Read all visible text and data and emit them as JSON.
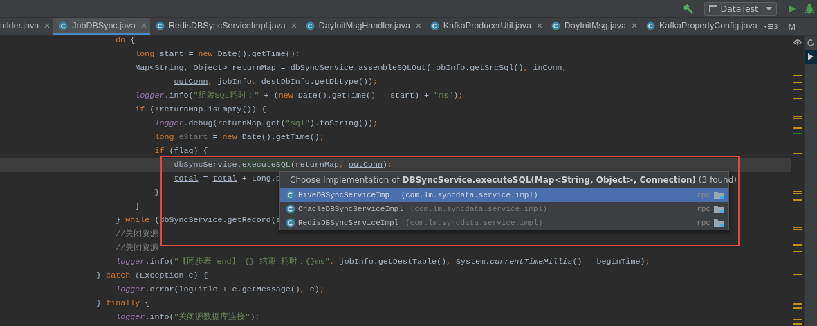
{
  "toolbar": {
    "run_config": "DataTest"
  },
  "tabs": [
    {
      "label": "uilder.java",
      "kind": "cut",
      "selected": false
    },
    {
      "label": "JobDBSync.java",
      "kind": "class",
      "selected": true
    },
    {
      "label": "RedisDBSyncServiceImpl.java",
      "kind": "class",
      "selected": false
    },
    {
      "label": "DayInitMsgHandler.java",
      "kind": "class",
      "selected": false
    },
    {
      "label": "KafkaProducerUtil.java",
      "kind": "class",
      "selected": false
    },
    {
      "label": "DayInitMsg.java",
      "kind": "class",
      "selected": false
    },
    {
      "label": "KafkaPropertyConfig.java",
      "kind": "class",
      "selected": false
    }
  ],
  "hidden_tabs_count": "3",
  "cut_tab": "M",
  "code_lines": [
    {
      "current": false,
      "tokens": [
        {
          "kind": "keyword",
          "text": "                    do"
        },
        {
          "kind": "plain",
          "text": " {"
        }
      ]
    },
    {
      "current": false,
      "tokens": [
        {
          "kind": "keyword",
          "text": "                        long"
        },
        {
          "kind": "plain",
          "text": " start = "
        },
        {
          "kind": "keyword",
          "text": "new"
        },
        {
          "kind": "plain",
          "text": " Date().getTime()"
        },
        {
          "kind": "keyword",
          "text": ";"
        }
      ]
    },
    {
      "current": false,
      "tokens": [
        {
          "kind": "plain",
          "text": "                        Map<String, Object> returnMap = dbSyncService.assembleSQLOut(jobInfo.getSrcSql()"
        },
        {
          "kind": "keyword",
          "text": ", "
        },
        {
          "kind": "reassigned",
          "text": "inConn"
        },
        {
          "kind": "keyword",
          "text": ","
        }
      ]
    },
    {
      "current": false,
      "tokens": [
        {
          "kind": "reassigned",
          "text": "                                outConn"
        },
        {
          "kind": "keyword",
          "text": ","
        },
        {
          "kind": "plain",
          "text": " jobInfo"
        },
        {
          "kind": "keyword",
          "text": ","
        },
        {
          "kind": "plain",
          "text": " destDbInfo.getDbtype())"
        },
        {
          "kind": "keyword",
          "text": ";"
        }
      ]
    },
    {
      "current": false,
      "tokens": [
        {
          "kind": "field",
          "text": "                        logger"
        },
        {
          "kind": "plain",
          "text": ".info("
        },
        {
          "kind": "string",
          "text": "\"组装SQL耗时：\""
        },
        {
          "kind": "plain",
          "text": " + ("
        },
        {
          "kind": "keyword",
          "text": "new"
        },
        {
          "kind": "plain",
          "text": " Date().getTime() - start) + "
        },
        {
          "kind": "string",
          "text": "\"ms\""
        },
        {
          "kind": "plain",
          "text": ")"
        },
        {
          "kind": "keyword",
          "text": ";"
        }
      ]
    },
    {
      "current": false,
      "tokens": [
        {
          "kind": "keyword",
          "text": "                        if"
        },
        {
          "kind": "plain",
          "text": " (!returnMap.isEmpty()) {"
        }
      ]
    },
    {
      "current": false,
      "tokens": [
        {
          "kind": "field",
          "text": "                            logger"
        },
        {
          "kind": "plain",
          "text": ".debug(returnMap.get("
        },
        {
          "kind": "string",
          "text": "\"sql\""
        },
        {
          "kind": "plain",
          "text": ").toString())"
        },
        {
          "kind": "keyword",
          "text": ";"
        }
      ]
    },
    {
      "current": false,
      "tokens": [
        {
          "kind": "keyword",
          "text": "                            long"
        },
        {
          "kind": "unused",
          "text": " eStart"
        },
        {
          "kind": "plain",
          "text": " = "
        },
        {
          "kind": "keyword",
          "text": "new"
        },
        {
          "kind": "plain",
          "text": " Date().getTime()"
        },
        {
          "kind": "keyword",
          "text": ";"
        }
      ]
    },
    {
      "current": false,
      "tokens": [
        {
          "kind": "keyword",
          "text": "                            if"
        },
        {
          "kind": "plain",
          "text": " ("
        },
        {
          "kind": "reassigned",
          "text": "flag"
        },
        {
          "kind": "plain",
          "text": ") {"
        }
      ]
    },
    {
      "current": true,
      "tokens": [
        {
          "kind": "plain",
          "text": "                                dbSyncService."
        },
        {
          "kind": "usage",
          "text": "executeSQL"
        },
        {
          "kind": "plain",
          "text": "(returnMap"
        },
        {
          "kind": "keyword",
          "text": ", "
        },
        {
          "kind": "reassigned",
          "text": "outConn"
        },
        {
          "kind": "plain",
          "text": ")"
        },
        {
          "kind": "keyword",
          "text": ";"
        }
      ]
    },
    {
      "current": false,
      "tokens": [
        {
          "kind": "reassigned",
          "text": "                                total"
        },
        {
          "kind": "plain",
          "text": " = "
        },
        {
          "kind": "reassigned",
          "text": "total"
        },
        {
          "kind": "plain",
          "text": " + Long.p"
        }
      ]
    },
    {
      "current": false,
      "tokens": [
        {
          "kind": "plain",
          "text": "                            }"
        }
      ]
    },
    {
      "current": false,
      "tokens": [
        {
          "kind": "plain",
          "text": "                        }"
        }
      ]
    },
    {
      "current": false,
      "tokens": [
        {
          "kind": "plain",
          "text": "                    } "
        },
        {
          "kind": "keyword",
          "text": "while"
        },
        {
          "kind": "plain",
          "text": " (dbSyncService.getRecord(s"
        }
      ]
    },
    {
      "current": false,
      "tokens": [
        {
          "kind": "comment",
          "text": "                    //关闭资源"
        }
      ]
    },
    {
      "current": false,
      "tokens": [
        {
          "kind": "comment",
          "text": "                    //关闭资源"
        }
      ]
    },
    {
      "current": false,
      "tokens": [
        {
          "kind": "field",
          "text": "                    logger"
        },
        {
          "kind": "plain",
          "text": ".info("
        },
        {
          "kind": "string",
          "text": "\"【同步表-end】 {} 结束 耗时：{}ms\""
        },
        {
          "kind": "keyword",
          "text": ","
        },
        {
          "kind": "plain",
          "text": " jobInfo.getDestTable()"
        },
        {
          "kind": "keyword",
          "text": ","
        },
        {
          "kind": "plain",
          "text": " System."
        },
        {
          "kind": "static",
          "text": "currentTimeMillis"
        },
        {
          "kind": "plain",
          "text": "() - beginTime)"
        },
        {
          "kind": "keyword",
          "text": ";"
        }
      ]
    },
    {
      "current": false,
      "tokens": [
        {
          "kind": "plain",
          "text": "                } "
        },
        {
          "kind": "keyword",
          "text": "catch"
        },
        {
          "kind": "plain",
          "text": " (Exception e) {"
        }
      ]
    },
    {
      "current": false,
      "tokens": [
        {
          "kind": "field",
          "text": "                    logger"
        },
        {
          "kind": "plain",
          "text": ".error(logTitle + e.getMessage()"
        },
        {
          "kind": "keyword",
          "text": ","
        },
        {
          "kind": "plain",
          "text": " e)"
        },
        {
          "kind": "keyword",
          "text": ";"
        }
      ]
    },
    {
      "current": false,
      "tokens": [
        {
          "kind": "plain",
          "text": "                } "
        },
        {
          "kind": "keyword",
          "text": "finally"
        },
        {
          "kind": "plain",
          "text": " {"
        }
      ]
    },
    {
      "current": false,
      "tokens": [
        {
          "kind": "field",
          "text": "                    logger"
        },
        {
          "kind": "plain",
          "text": ".info("
        },
        {
          "kind": "string",
          "text": "\"关闭源数据库连接\""
        },
        {
          "kind": "plain",
          "text": ")"
        },
        {
          "kind": "keyword",
          "text": ";"
        }
      ]
    }
  ],
  "popup": {
    "title": "Choose Implementation of **DBSyncService.executeSQL(Map<String, Object>, Connection)** (3 found)",
    "items": [
      {
        "name": "HiveDBSyncServiceImpl",
        "package": "(com.lm.syncdata.service.impl)",
        "module": "rpc",
        "selected": true
      },
      {
        "name": "OracleDBSyncServiceImpl",
        "package": "(com.lm.syncdata.service.impl)",
        "module": "rpc",
        "selected": false
      },
      {
        "name": "RedisDBSyncServiceImpl",
        "package": "(com.lm.syncdata.service.impl)",
        "module": "rpc",
        "selected": false
      }
    ]
  }
}
